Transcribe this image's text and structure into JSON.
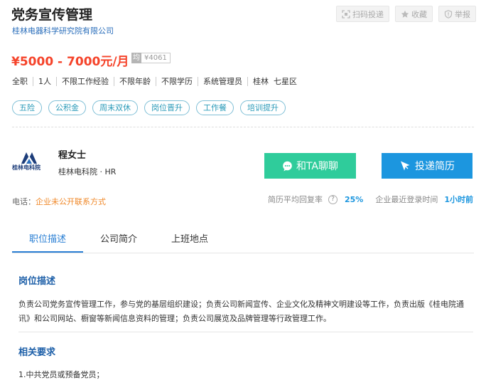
{
  "job": {
    "title": "党务宣传管理",
    "company": "桂林电器科学研究院有限公司",
    "salary": "¥5000 - 7000元/月",
    "avg_label": "均",
    "avg_value": "¥4061",
    "details": [
      "全职",
      "1人",
      "不限工作经验",
      "不限年龄",
      "不限学历",
      "系统管理员",
      "桂林  七星区"
    ],
    "tags": [
      "五险",
      "公积金",
      "周末双休",
      "岗位晋升",
      "工作餐",
      "培训提升"
    ]
  },
  "actions": {
    "scan_apply": "扫码投递",
    "favorite": "收藏",
    "report": "举报"
  },
  "recruiter": {
    "logo_text": "桂林电科院",
    "name": "程女士",
    "company_role": "桂林电科院 · HR",
    "chat_label": "和TA聊聊",
    "apply_label": "投递简历"
  },
  "contact": {
    "phone_label": "电话：",
    "phone_value": "企业未公开联系方式"
  },
  "stats": {
    "reply_rate_label": "简历平均回复率",
    "reply_rate_value": "25%",
    "last_login_label": "企业最近登录时间",
    "last_login_value": "1小时前"
  },
  "tabs": [
    "职位描述",
    "公司简介",
    "上班地点"
  ],
  "description": {
    "title": "岗位描述",
    "text": "负责公司党务宣传管理工作，参与党的基层组织建设；负责公司新闻宣传、企业文化及精神文明建设等工作，负责出版《桂电院通讯》和公司网站、橱窗等新闻信息资料的管理；负责公司展览及品牌管理等行政管理工作。"
  },
  "requirements": {
    "title": "相关要求",
    "item1": "1.中共党员或预备党员；"
  },
  "colors": {
    "salary": "#f5432a",
    "chat_button": "#2fcc9b",
    "apply_button": "#1c96df",
    "tag_text": "#2a9ab8",
    "section_title": "#1d5fa8"
  }
}
